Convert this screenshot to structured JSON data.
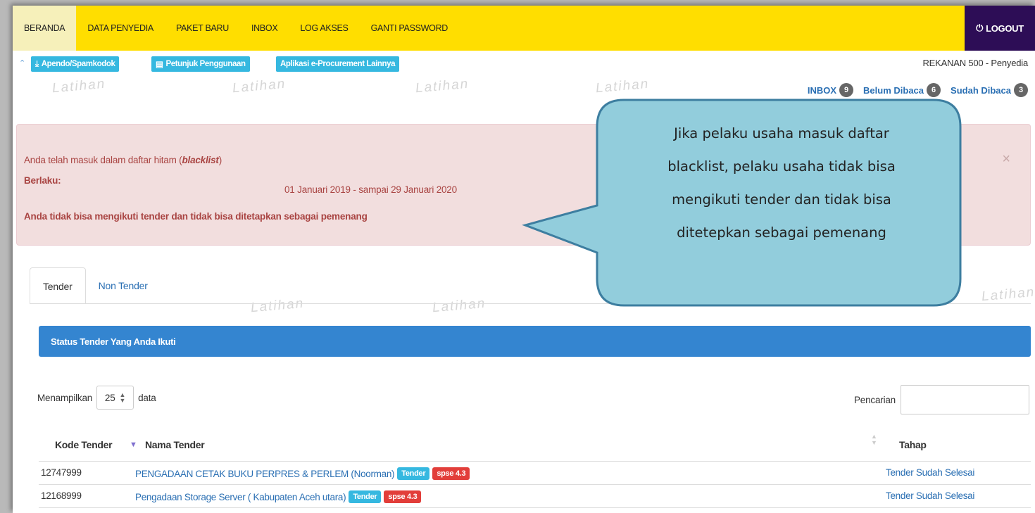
{
  "nav": {
    "items": [
      {
        "label": "BERANDA",
        "active": true
      },
      {
        "label": "DATA PENYEDIA",
        "active": false
      },
      {
        "label": "PAKET BARU",
        "active": false
      },
      {
        "label": "INBOX",
        "active": false
      },
      {
        "label": "LOG AKSES",
        "active": false
      },
      {
        "label": "GANTI PASSWORD",
        "active": false
      }
    ],
    "logout_label": "LOGOUT",
    "bg_color": "#ffde00",
    "logout_color": "#2d0d56"
  },
  "subbar": {
    "apendo_label": "Apendo/Spamkodok",
    "petunjuk_label": "Petunjuk Penggunaan",
    "aplikasi_label": "Aplikasi e-Procurement Lainnya",
    "user_label": "REKANAN 500 - Penyedia"
  },
  "watermark": "Latihan",
  "inbox": {
    "inbox_label": "INBOX",
    "inbox_count": "9",
    "unread_label": "Belum Dibaca",
    "unread_count": "6",
    "read_label": "Sudah Dibaca",
    "read_count": "3"
  },
  "alert": {
    "line1_prefix": "Anda telah masuk dalam daftar hitam (",
    "line1_em": "blacklist",
    "line1_suffix": ")",
    "valid_label": "Berlaku:",
    "period": "01 Januari 2019 - sampai 29 Januari 2020",
    "line3": "Anda tidak bisa mengikuti tender dan tidak bisa ditetapkan sebagai pemenang",
    "close": "×"
  },
  "callout": {
    "lines": [
      "Jika pelaku usaha masuk daftar",
      "blacklist, pelaku usaha tidak bisa",
      "mengikuti tender dan tidak bisa",
      "ditetepkan sebagai pemenang"
    ],
    "fill_color": "#92cddc",
    "border_color": "#3d7ea0"
  },
  "tabs": {
    "tender": "Tender",
    "non_tender": "Non Tender"
  },
  "panel": {
    "title": "Status Tender Yang Anda Ikuti",
    "color": "#3485d0"
  },
  "table_controls": {
    "show_prefix": "Menampilkan",
    "page_length": "25",
    "show_suffix": "data",
    "search_label": "Pencarian",
    "search_value": ""
  },
  "table": {
    "columns": [
      "Kode Tender",
      "Nama Tender",
      "Tahap"
    ],
    "rows": [
      {
        "code": "12747999",
        "name": "PENGADAAN CETAK BUKU PERPRES & PERLEM (Noorman)",
        "type": "Tender",
        "version": "spse 4.3",
        "stage": "Tender Sudah Selesai"
      },
      {
        "code": "12168999",
        "name": "Pengadaan Storage Server ( Kabupaten Aceh utara)",
        "type": "Tender",
        "version": "spse 4.3",
        "stage": "Tender Sudah Selesai"
      }
    ]
  }
}
